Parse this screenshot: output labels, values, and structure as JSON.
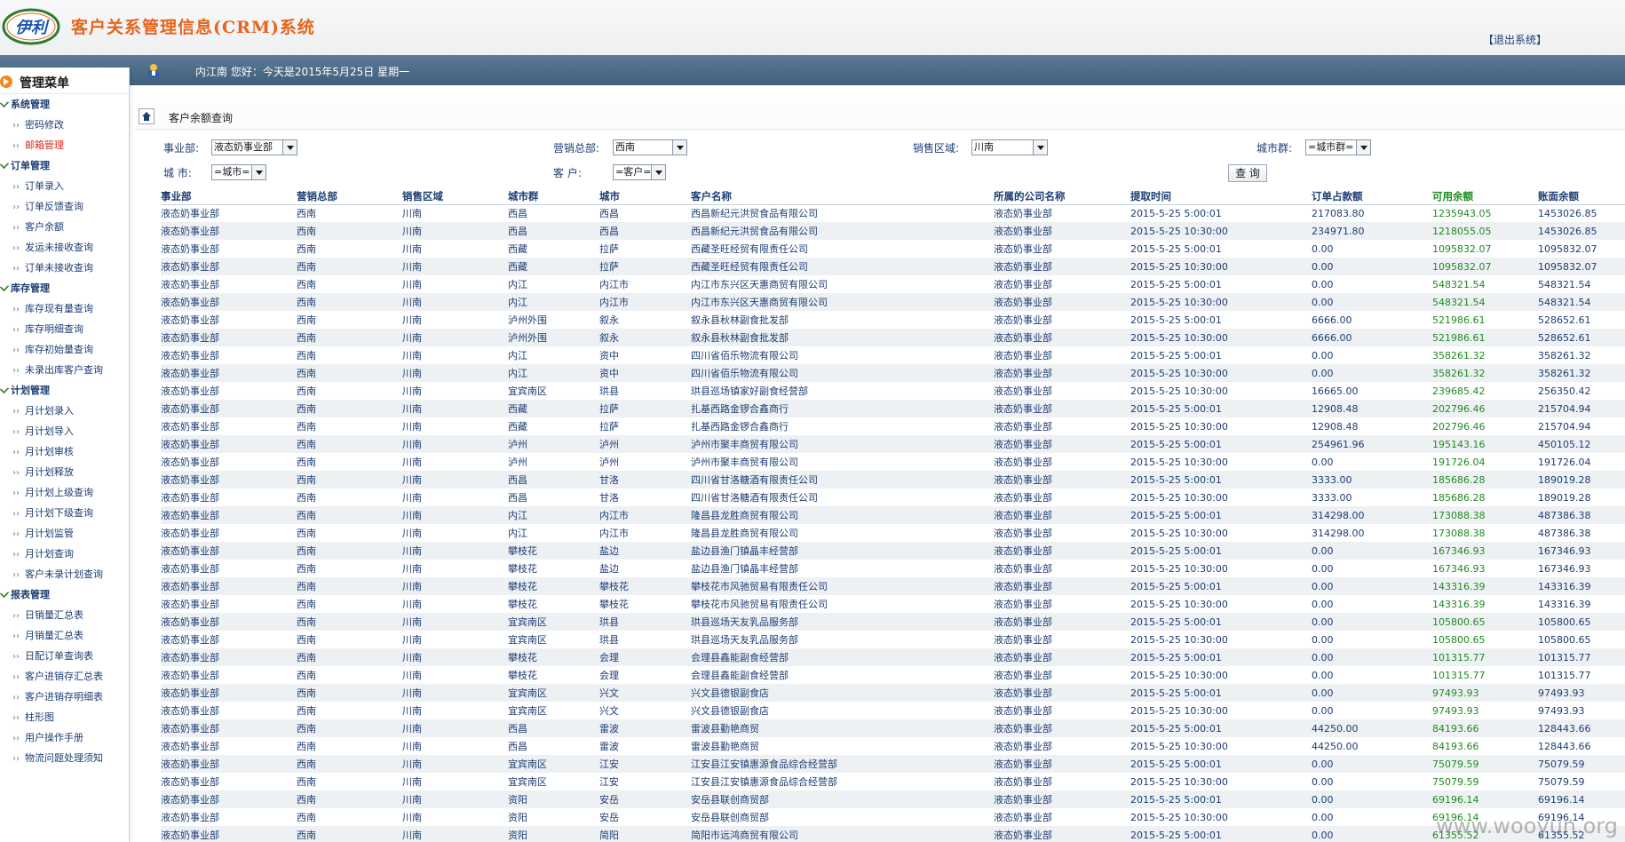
{
  "header": {
    "system_title": "客户关系管理信息(CRM)系统",
    "logo_text": "伊利",
    "logout_label": "【退出系统】"
  },
  "topbar": {
    "welcome": "内江南  您好：今天是2015年5月25日   星期一"
  },
  "sidebar": {
    "title": "管理菜单",
    "groups": [
      {
        "title": "系统管理",
        "items": [
          "密码修改",
          "邮箱管理"
        ]
      },
      {
        "title": "订单管理",
        "items": [
          "订单录入",
          "订单反馈查询",
          "客户余额",
          "发运未接收查询",
          "订单未接收查询"
        ]
      },
      {
        "title": "库存管理",
        "items": [
          "库存现有量查询",
          "库存明细查询",
          "库存初始量查询",
          "未录出库客户查询"
        ]
      },
      {
        "title": "计划管理",
        "items": [
          "月计划录入",
          "月计划导入",
          "月计划审核",
          "月计划释放",
          "月计划上级查询",
          "月计划下级查询",
          "月计划监管",
          "月计划查询",
          "客户未录计划查询"
        ]
      },
      {
        "title": "报表管理",
        "items": [
          "日销量汇总表",
          "月销量汇总表",
          "日配订单查询表",
          "客户进销存汇总表",
          "客户进销存明细表",
          "柱形图",
          "用户操作手册",
          "物流问题处理须知"
        ]
      }
    ],
    "active_item": "邮箱管理"
  },
  "main": {
    "page_title": "客户余额查询",
    "filters": {
      "business_label": "事业部:",
      "business_value": "液态奶事业部",
      "sales_hq_label": "营销总部:",
      "sales_hq_value": "西南",
      "sales_region_label": "销售区域:",
      "sales_region_value": "川南",
      "city_group_label": "城市群:",
      "city_group_value": "=城市群=",
      "city_label": "城    市:",
      "city_value": "=城市=",
      "customer_label": "客    户:",
      "customer_value": "=客户=",
      "query_label": "查 询"
    },
    "table": {
      "headers": [
        "事业部",
        "营销总部",
        "销售区域",
        "城市群",
        "城市",
        "客户名称",
        "所属的公司名称",
        "提取时间",
        "订单占款额",
        "可用余额",
        "账面余额"
      ],
      "rows": [
        [
          "液态奶事业部",
          "西南",
          "川南",
          "西昌",
          "西昌",
          "西昌新纪元洪贸食品有限公司",
          "液态奶事业部",
          "2015-5-25 5:00:01",
          "217083.80",
          "1235943.05",
          "1453026.85"
        ],
        [
          "液态奶事业部",
          "西南",
          "川南",
          "西昌",
          "西昌",
          "西昌新纪元洪贸食品有限公司",
          "液态奶事业部",
          "2015-5-25 10:30:00",
          "234971.80",
          "1218055.05",
          "1453026.85"
        ],
        [
          "液态奶事业部",
          "西南",
          "川南",
          "西藏",
          "拉萨",
          "西藏圣旺经贸有限责任公司",
          "液态奶事业部",
          "2015-5-25 5:00:01",
          "0.00",
          "1095832.07",
          "1095832.07"
        ],
        [
          "液态奶事业部",
          "西南",
          "川南",
          "西藏",
          "拉萨",
          "西藏圣旺经贸有限责任公司",
          "液态奶事业部",
          "2015-5-25 10:30:00",
          "0.00",
          "1095832.07",
          "1095832.07"
        ],
        [
          "液态奶事业部",
          "西南",
          "川南",
          "内江",
          "内江市",
          "内江市东兴区天惠商贸有限公司",
          "液态奶事业部",
          "2015-5-25 5:00:01",
          "0.00",
          "548321.54",
          "548321.54"
        ],
        [
          "液态奶事业部",
          "西南",
          "川南",
          "内江",
          "内江市",
          "内江市东兴区天惠商贸有限公司",
          "液态奶事业部",
          "2015-5-25 10:30:00",
          "0.00",
          "548321.54",
          "548321.54"
        ],
        [
          "液态奶事业部",
          "西南",
          "川南",
          "泸州外围",
          "叙永",
          "叙永县秋林副食批发部",
          "液态奶事业部",
          "2015-5-25 5:00:01",
          "6666.00",
          "521986.61",
          "528652.61"
        ],
        [
          "液态奶事业部",
          "西南",
          "川南",
          "泸州外围",
          "叙永",
          "叙永县秋林副食批发部",
          "液态奶事业部",
          "2015-5-25 10:30:00",
          "6666.00",
          "521986.61",
          "528652.61"
        ],
        [
          "液态奶事业部",
          "西南",
          "川南",
          "内江",
          "资中",
          "四川省佰乐物流有限公司",
          "液态奶事业部",
          "2015-5-25 5:00:01",
          "0.00",
          "358261.32",
          "358261.32"
        ],
        [
          "液态奶事业部",
          "西南",
          "川南",
          "内江",
          "资中",
          "四川省佰乐物流有限公司",
          "液态奶事业部",
          "2015-5-25 10:30:00",
          "0.00",
          "358261.32",
          "358261.32"
        ],
        [
          "液态奶事业部",
          "西南",
          "川南",
          "宜宾南区",
          "珙县",
          "珙县巡场镇家好副食经营部",
          "液态奶事业部",
          "2015-5-25 10:30:00",
          "16665.00",
          "239685.42",
          "256350.42"
        ],
        [
          "液态奶事业部",
          "西南",
          "川南",
          "西藏",
          "拉萨",
          "扎基西路金锣合鑫商行",
          "液态奶事业部",
          "2015-5-25 5:00:01",
          "12908.48",
          "202796.46",
          "215704.94"
        ],
        [
          "液态奶事业部",
          "西南",
          "川南",
          "西藏",
          "拉萨",
          "扎基西路金锣合鑫商行",
          "液态奶事业部",
          "2015-5-25 10:30:00",
          "12908.48",
          "202796.46",
          "215704.94"
        ],
        [
          "液态奶事业部",
          "西南",
          "川南",
          "泸州",
          "泸州",
          "泸州市聚丰商贸有限公司",
          "液态奶事业部",
          "2015-5-25 5:00:01",
          "254961.96",
          "195143.16",
          "450105.12"
        ],
        [
          "液态奶事业部",
          "西南",
          "川南",
          "泸州",
          "泸州",
          "泸州市聚丰商贸有限公司",
          "液态奶事业部",
          "2015-5-25 10:30:00",
          "0.00",
          "191726.04",
          "191726.04"
        ],
        [
          "液态奶事业部",
          "西南",
          "川南",
          "西昌",
          "甘洛",
          "四川省甘洛糖酒有限责任公司",
          "液态奶事业部",
          "2015-5-25 5:00:01",
          "3333.00",
          "185686.28",
          "189019.28"
        ],
        [
          "液态奶事业部",
          "西南",
          "川南",
          "西昌",
          "甘洛",
          "四川省甘洛糖酒有限责任公司",
          "液态奶事业部",
          "2015-5-25 10:30:00",
          "3333.00",
          "185686.28",
          "189019.28"
        ],
        [
          "液态奶事业部",
          "西南",
          "川南",
          "内江",
          "内江市",
          "隆昌县龙胜商贸有限公司",
          "液态奶事业部",
          "2015-5-25 5:00:01",
          "314298.00",
          "173088.38",
          "487386.38"
        ],
        [
          "液态奶事业部",
          "西南",
          "川南",
          "内江",
          "内江市",
          "隆昌县龙胜商贸有限公司",
          "液态奶事业部",
          "2015-5-25 10:30:00",
          "314298.00",
          "173088.38",
          "487386.38"
        ],
        [
          "液态奶事业部",
          "西南",
          "川南",
          "攀枝花",
          "盐边",
          "盐边县渔门镇晶丰经营部",
          "液态奶事业部",
          "2015-5-25 5:00:01",
          "0.00",
          "167346.93",
          "167346.93"
        ],
        [
          "液态奶事业部",
          "西南",
          "川南",
          "攀枝花",
          "盐边",
          "盐边县渔门镇晶丰经营部",
          "液态奶事业部",
          "2015-5-25 10:30:00",
          "0.00",
          "167346.93",
          "167346.93"
        ],
        [
          "液态奶事业部",
          "西南",
          "川南",
          "攀枝花",
          "攀枝花",
          "攀枝花市风驰贸易有限责任公司",
          "液态奶事业部",
          "2015-5-25 5:00:01",
          "0.00",
          "143316.39",
          "143316.39"
        ],
        [
          "液态奶事业部",
          "西南",
          "川南",
          "攀枝花",
          "攀枝花",
          "攀枝花市风驰贸易有限责任公司",
          "液态奶事业部",
          "2015-5-25 10:30:00",
          "0.00",
          "143316.39",
          "143316.39"
        ],
        [
          "液态奶事业部",
          "西南",
          "川南",
          "宜宾南区",
          "珙县",
          "珙县巡场天友乳品服务部",
          "液态奶事业部",
          "2015-5-25 5:00:01",
          "0.00",
          "105800.65",
          "105800.65"
        ],
        [
          "液态奶事业部",
          "西南",
          "川南",
          "宜宾南区",
          "珙县",
          "珙县巡场天友乳品服务部",
          "液态奶事业部",
          "2015-5-25 10:30:00",
          "0.00",
          "105800.65",
          "105800.65"
        ],
        [
          "液态奶事业部",
          "西南",
          "川南",
          "攀枝花",
          "会理",
          "会理县鑫能副食经营部",
          "液态奶事业部",
          "2015-5-25 5:00:01",
          "0.00",
          "101315.77",
          "101315.77"
        ],
        [
          "液态奶事业部",
          "西南",
          "川南",
          "攀枝花",
          "会理",
          "会理县鑫能副食经营部",
          "液态奶事业部",
          "2015-5-25 10:30:00",
          "0.00",
          "101315.77",
          "101315.77"
        ],
        [
          "液态奶事业部",
          "西南",
          "川南",
          "宜宾南区",
          "兴文",
          "兴文县德银副食店",
          "液态奶事业部",
          "2015-5-25 5:00:01",
          "0.00",
          "97493.93",
          "97493.93"
        ],
        [
          "液态奶事业部",
          "西南",
          "川南",
          "宜宾南区",
          "兴文",
          "兴文县德银副食店",
          "液态奶事业部",
          "2015-5-25 10:30:00",
          "0.00",
          "97493.93",
          "97493.93"
        ],
        [
          "液态奶事业部",
          "西南",
          "川南",
          "西昌",
          "雷波",
          "雷波县勤艳商贸",
          "液态奶事业部",
          "2015-5-25 5:00:01",
          "44250.00",
          "84193.66",
          "128443.66"
        ],
        [
          "液态奶事业部",
          "西南",
          "川南",
          "西昌",
          "雷波",
          "雷波县勤艳商贸",
          "液态奶事业部",
          "2015-5-25 10:30:00",
          "44250.00",
          "84193.66",
          "128443.66"
        ],
        [
          "液态奶事业部",
          "西南",
          "川南",
          "宜宾南区",
          "江安",
          "江安县江安镇惠源食品综合经营部",
          "液态奶事业部",
          "2015-5-25 5:00:01",
          "0.00",
          "75079.59",
          "75079.59"
        ],
        [
          "液态奶事业部",
          "西南",
          "川南",
          "宜宾南区",
          "江安",
          "江安县江安镇惠源食品综合经营部",
          "液态奶事业部",
          "2015-5-25 10:30:00",
          "0.00",
          "75079.59",
          "75079.59"
        ],
        [
          "液态奶事业部",
          "西南",
          "川南",
          "资阳",
          "安岳",
          "安岳县联创商贸部",
          "液态奶事业部",
          "2015-5-25 5:00:01",
          "0.00",
          "69196.14",
          "69196.14"
        ],
        [
          "液态奶事业部",
          "西南",
          "川南",
          "资阳",
          "安岳",
          "安岳县联创商贸部",
          "液态奶事业部",
          "2015-5-25 10:30:00",
          "0.00",
          "69196.14",
          "69196.14"
        ],
        [
          "液态奶事业部",
          "西南",
          "川南",
          "资阳",
          "简阳",
          "简阳市远鸿商贸有限公司",
          "液态奶事业部",
          "2015-5-25 5:00:01",
          "0.00",
          "61355.52",
          "61355.52"
        ]
      ]
    }
  },
  "watermark": "www.wooyun.org",
  "colors": {
    "topbar": "#4a6a86",
    "text_blue": "#1c3d73",
    "available_green": "#1f8a1f",
    "title_orange": "#e8641a",
    "active_red": "#e0261a"
  },
  "icons": {
    "logo": "yili-logo",
    "user": "user-icon",
    "home": "home-icon",
    "menu": "arrow-right-circle-icon",
    "group": "check-icon",
    "dropdown": "chevron-down-icon"
  }
}
